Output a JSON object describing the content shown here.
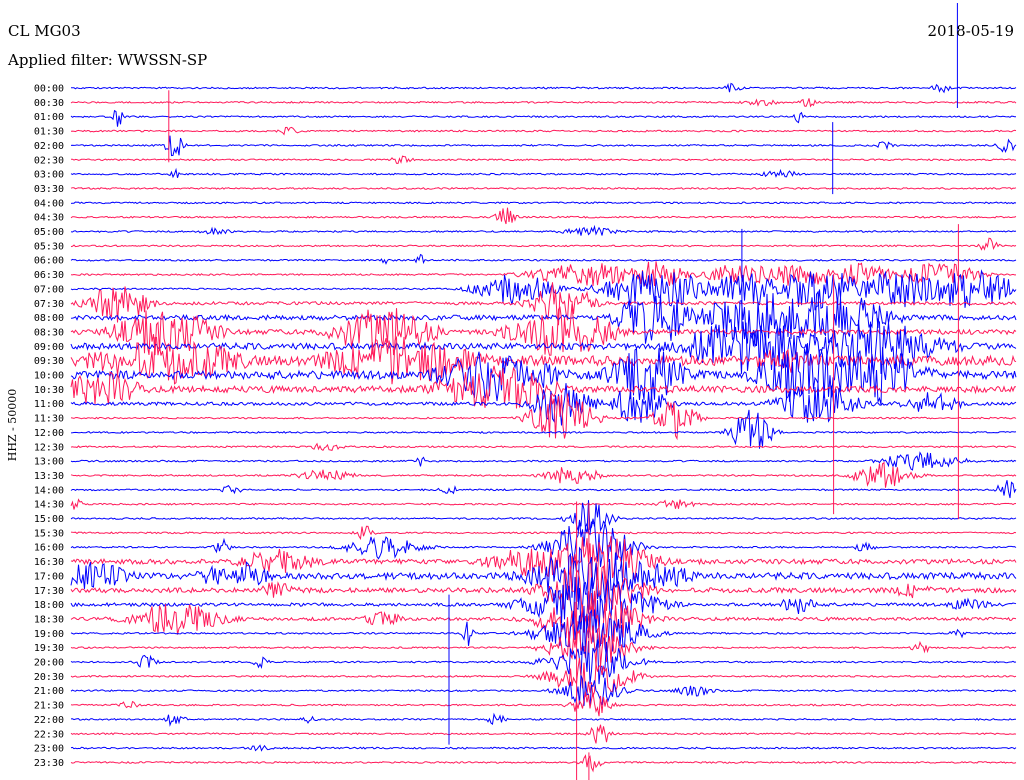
{
  "header": {
    "station": "CL MG03",
    "date": "2018-05-19",
    "filter": "Applied filter: WWSSN-SP"
  },
  "chart_data": {
    "type": "helicorder",
    "channel_label": "HHZ - 50000",
    "colors": [
      "#0000ff",
      "#ff1a5a"
    ],
    "row_labels": [
      "00:00",
      "00:30",
      "01:00",
      "01:30",
      "02:00",
      "02:30",
      "03:00",
      "03:30",
      "04:00",
      "04:30",
      "05:00",
      "05:30",
      "06:00",
      "06:30",
      "07:00",
      "07:30",
      "08:00",
      "08:30",
      "09:00",
      "09:30",
      "10:00",
      "10:30",
      "11:00",
      "11:30",
      "12:00",
      "12:30",
      "13:00",
      "13:30",
      "14:00",
      "14:30",
      "15:00",
      "15:30",
      "16:00",
      "16:30",
      "17:00",
      "17:30",
      "18:00",
      "18:30",
      "19:00",
      "19:30",
      "20:00",
      "20:30",
      "21:00",
      "21:30",
      "22:00",
      "22:30",
      "23:00",
      "23:30"
    ],
    "noise_level": [
      1,
      1,
      1,
      1,
      1,
      1,
      1,
      1,
      1,
      1,
      1,
      1,
      1,
      1,
      1,
      2,
      3,
      3,
      4,
      6,
      5,
      4,
      2,
      1,
      1,
      1,
      1,
      1,
      1,
      1,
      1,
      1,
      1,
      3,
      4,
      3,
      2,
      2,
      1,
      1,
      1,
      1,
      1,
      1,
      1,
      1,
      1,
      1
    ],
    "bursts": [
      {
        "row": 0,
        "x": 0.7,
        "amp": 5,
        "dur": 0.01
      },
      {
        "row": 0,
        "x": 0.92,
        "amp": 5,
        "dur": 0.01
      },
      {
        "row": 1,
        "x": 0.73,
        "amp": 4,
        "dur": 0.02
      },
      {
        "row": 1,
        "x": 0.78,
        "amp": 5,
        "dur": 0.01
      },
      {
        "row": 2,
        "x": 0.05,
        "amp": 12,
        "dur": 0.005
      },
      {
        "row": 2,
        "x": 0.77,
        "amp": 6,
        "dur": 0.005
      },
      {
        "row": 3,
        "x": 0.23,
        "amp": 5,
        "dur": 0.01
      },
      {
        "row": 4,
        "x": 0.11,
        "amp": 14,
        "dur": 0.01
      },
      {
        "row": 4,
        "x": 0.86,
        "amp": 4,
        "dur": 0.01
      },
      {
        "row": 4,
        "x": 0.99,
        "amp": 8,
        "dur": 0.01
      },
      {
        "row": 5,
        "x": 0.35,
        "amp": 6,
        "dur": 0.01
      },
      {
        "row": 6,
        "x": 0.11,
        "amp": 6,
        "dur": 0.005
      },
      {
        "row": 6,
        "x": 0.75,
        "amp": 4,
        "dur": 0.02
      },
      {
        "row": 9,
        "x": 0.46,
        "amp": 10,
        "dur": 0.01
      },
      {
        "row": 10,
        "x": 0.15,
        "amp": 4,
        "dur": 0.02
      },
      {
        "row": 10,
        "x": 0.55,
        "amp": 5,
        "dur": 0.03
      },
      {
        "row": 11,
        "x": 0.97,
        "amp": 8,
        "dur": 0.01
      },
      {
        "row": 12,
        "x": 0.33,
        "amp": 6,
        "dur": 0.005
      },
      {
        "row": 12,
        "x": 0.37,
        "amp": 6,
        "dur": 0.005
      },
      {
        "row": 13,
        "x": 0.55,
        "amp": 12,
        "dur": 0.06
      },
      {
        "row": 13,
        "x": 0.62,
        "amp": 14,
        "dur": 0.03
      },
      {
        "row": 13,
        "x": 0.71,
        "amp": 12,
        "dur": 0.04
      },
      {
        "row": 13,
        "x": 0.77,
        "amp": 12,
        "dur": 0.05
      },
      {
        "row": 13,
        "x": 0.83,
        "amp": 12,
        "dur": 0.04
      },
      {
        "row": 13,
        "x": 0.92,
        "amp": 12,
        "dur": 0.04
      },
      {
        "row": 14,
        "x": 0.47,
        "amp": 16,
        "dur": 0.04
      },
      {
        "row": 14,
        "x": 0.6,
        "amp": 18,
        "dur": 0.04
      },
      {
        "row": 14,
        "x": 0.64,
        "amp": 18,
        "dur": 0.03
      },
      {
        "row": 14,
        "x": 0.71,
        "amp": 20,
        "dur": 0.04
      },
      {
        "row": 14,
        "x": 0.79,
        "amp": 22,
        "dur": 0.05
      },
      {
        "row": 14,
        "x": 0.87,
        "amp": 20,
        "dur": 0.05
      },
      {
        "row": 14,
        "x": 0.95,
        "amp": 20,
        "dur": 0.05
      },
      {
        "row": 15,
        "x": 0.05,
        "amp": 22,
        "dur": 0.03
      },
      {
        "row": 15,
        "x": 0.52,
        "amp": 24,
        "dur": 0.03
      },
      {
        "row": 16,
        "x": 0.62,
        "amp": 30,
        "dur": 0.04
      },
      {
        "row": 16,
        "x": 0.73,
        "amp": 30,
        "dur": 0.06
      },
      {
        "row": 16,
        "x": 0.8,
        "amp": 30,
        "dur": 0.06
      },
      {
        "row": 17,
        "x": 0.1,
        "amp": 26,
        "dur": 0.05
      },
      {
        "row": 17,
        "x": 0.33,
        "amp": 26,
        "dur": 0.05
      },
      {
        "row": 17,
        "x": 0.52,
        "amp": 30,
        "dur": 0.05
      },
      {
        "row": 18,
        "x": 0.72,
        "amp": 30,
        "dur": 0.07
      },
      {
        "row": 18,
        "x": 0.85,
        "amp": 28,
        "dur": 0.07
      },
      {
        "row": 19,
        "x": 0.1,
        "amp": 24,
        "dur": 0.08
      },
      {
        "row": 19,
        "x": 0.35,
        "amp": 24,
        "dur": 0.08
      },
      {
        "row": 19,
        "x": 0.76,
        "amp": 14,
        "dur": 0.04
      },
      {
        "row": 20,
        "x": 0.45,
        "amp": 26,
        "dur": 0.06
      },
      {
        "row": 20,
        "x": 0.61,
        "amp": 30,
        "dur": 0.04
      },
      {
        "row": 20,
        "x": 0.78,
        "amp": 32,
        "dur": 0.05
      },
      {
        "row": 20,
        "x": 0.85,
        "amp": 30,
        "dur": 0.05
      },
      {
        "row": 21,
        "x": 0.03,
        "amp": 20,
        "dur": 0.04
      },
      {
        "row": 21,
        "x": 0.45,
        "amp": 24,
        "dur": 0.06
      },
      {
        "row": 22,
        "x": 0.52,
        "amp": 24,
        "dur": 0.03
      },
      {
        "row": 22,
        "x": 0.6,
        "amp": 20,
        "dur": 0.03
      },
      {
        "row": 22,
        "x": 0.79,
        "amp": 22,
        "dur": 0.04
      },
      {
        "row": 22,
        "x": 0.91,
        "amp": 12,
        "dur": 0.03
      },
      {
        "row": 23,
        "x": 0.52,
        "amp": 28,
        "dur": 0.03
      },
      {
        "row": 23,
        "x": 0.64,
        "amp": 24,
        "dur": 0.02
      },
      {
        "row": 24,
        "x": 0.72,
        "amp": 24,
        "dur": 0.02
      },
      {
        "row": 25,
        "x": 0.27,
        "amp": 4,
        "dur": 0.02
      },
      {
        "row": 26,
        "x": 0.37,
        "amp": 6,
        "dur": 0.005
      },
      {
        "row": 26,
        "x": 0.9,
        "amp": 10,
        "dur": 0.04
      },
      {
        "row": 27,
        "x": 0.27,
        "amp": 6,
        "dur": 0.03
      },
      {
        "row": 27,
        "x": 0.53,
        "amp": 10,
        "dur": 0.03
      },
      {
        "row": 27,
        "x": 0.86,
        "amp": 14,
        "dur": 0.03
      },
      {
        "row": 28,
        "x": 0.17,
        "amp": 6,
        "dur": 0.01
      },
      {
        "row": 28,
        "x": 0.4,
        "amp": 5,
        "dur": 0.01
      },
      {
        "row": 28,
        "x": 0.99,
        "amp": 10,
        "dur": 0.01
      },
      {
        "row": 29,
        "x": 0.0,
        "amp": 10,
        "dur": 0.01
      },
      {
        "row": 29,
        "x": 0.64,
        "amp": 5,
        "dur": 0.02
      },
      {
        "row": 30,
        "x": 0.55,
        "amp": 20,
        "dur": 0.02
      },
      {
        "row": 31,
        "x": 0.31,
        "amp": 8,
        "dur": 0.01
      },
      {
        "row": 32,
        "x": 0.16,
        "amp": 8,
        "dur": 0.01
      },
      {
        "row": 32,
        "x": 0.33,
        "amp": 12,
        "dur": 0.04
      },
      {
        "row": 32,
        "x": 0.55,
        "amp": 30,
        "dur": 0.04
      },
      {
        "row": 32,
        "x": 0.84,
        "amp": 6,
        "dur": 0.01
      },
      {
        "row": 33,
        "x": 0.22,
        "amp": 14,
        "dur": 0.04
      },
      {
        "row": 33,
        "x": 0.49,
        "amp": 16,
        "dur": 0.05
      },
      {
        "row": 33,
        "x": 0.56,
        "amp": 30,
        "dur": 0.05
      },
      {
        "row": 34,
        "x": 0.02,
        "amp": 14,
        "dur": 0.05
      },
      {
        "row": 34,
        "x": 0.15,
        "amp": 10,
        "dur": 0.02
      },
      {
        "row": 34,
        "x": 0.19,
        "amp": 16,
        "dur": 0.02
      },
      {
        "row": 34,
        "x": 0.55,
        "amp": 30,
        "dur": 0.06
      },
      {
        "row": 34,
        "x": 0.62,
        "amp": 14,
        "dur": 0.04
      },
      {
        "row": 35,
        "x": 0.22,
        "amp": 10,
        "dur": 0.02
      },
      {
        "row": 35,
        "x": 0.55,
        "amp": 30,
        "dur": 0.05
      },
      {
        "row": 35,
        "x": 0.89,
        "amp": 8,
        "dur": 0.02
      },
      {
        "row": 36,
        "x": 0.55,
        "amp": 30,
        "dur": 0.06
      },
      {
        "row": 36,
        "x": 0.77,
        "amp": 10,
        "dur": 0.02
      },
      {
        "row": 36,
        "x": 0.95,
        "amp": 8,
        "dur": 0.02
      },
      {
        "row": 37,
        "x": 0.11,
        "amp": 16,
        "dur": 0.05
      },
      {
        "row": 37,
        "x": 0.33,
        "amp": 8,
        "dur": 0.02
      },
      {
        "row": 37,
        "x": 0.55,
        "amp": 30,
        "dur": 0.05
      },
      {
        "row": 38,
        "x": 0.42,
        "amp": 14,
        "dur": 0.005
      },
      {
        "row": 38,
        "x": 0.55,
        "amp": 28,
        "dur": 0.05
      },
      {
        "row": 38,
        "x": 0.94,
        "amp": 5,
        "dur": 0.01
      },
      {
        "row": 39,
        "x": 0.55,
        "amp": 24,
        "dur": 0.04
      },
      {
        "row": 39,
        "x": 0.9,
        "amp": 6,
        "dur": 0.01
      },
      {
        "row": 40,
        "x": 0.08,
        "amp": 8,
        "dur": 0.01
      },
      {
        "row": 40,
        "x": 0.2,
        "amp": 6,
        "dur": 0.01
      },
      {
        "row": 40,
        "x": 0.55,
        "amp": 24,
        "dur": 0.04
      },
      {
        "row": 41,
        "x": 0.55,
        "amp": 22,
        "dur": 0.04
      },
      {
        "row": 42,
        "x": 0.55,
        "amp": 18,
        "dur": 0.03
      },
      {
        "row": 42,
        "x": 0.66,
        "amp": 6,
        "dur": 0.02
      },
      {
        "row": 43,
        "x": 0.06,
        "amp": 5,
        "dur": 0.01
      },
      {
        "row": 43,
        "x": 0.55,
        "amp": 14,
        "dur": 0.02
      },
      {
        "row": 44,
        "x": 0.11,
        "amp": 8,
        "dur": 0.01
      },
      {
        "row": 44,
        "x": 0.25,
        "amp": 4,
        "dur": 0.01
      },
      {
        "row": 44,
        "x": 0.45,
        "amp": 6,
        "dur": 0.01
      },
      {
        "row": 45,
        "x": 0.56,
        "amp": 14,
        "dur": 0.01
      },
      {
        "row": 46,
        "x": 0.2,
        "amp": 4,
        "dur": 0.01
      },
      {
        "row": 47,
        "x": 0.55,
        "amp": 10,
        "dur": 0.01
      }
    ],
    "spikes": [
      {
        "row": 0,
        "x": 0.938,
        "up": 85,
        "down": 20
      },
      {
        "row": 1,
        "x": 0.1035,
        "up": 12,
        "down": 60
      },
      {
        "row": 6,
        "x": 0.806,
        "up": 52,
        "down": 20
      },
      {
        "row": 14,
        "x": 0.71,
        "up": 60,
        "down": 40
      },
      {
        "row": 29,
        "x": 0.807,
        "up": 230,
        "down": 10
      },
      {
        "row": 29,
        "x": 0.939,
        "up": 280,
        "down": 15
      },
      {
        "row": 33,
        "x": 0.535,
        "up": 60,
        "down": 300
      },
      {
        "row": 31,
        "x": 0.548,
        "up": 30,
        "down": 120
      },
      {
        "row": 36,
        "x": 0.4,
        "up": 10,
        "down": 140
      },
      {
        "row": 47,
        "x": 0.548,
        "up": 10,
        "down": 25
      }
    ]
  }
}
